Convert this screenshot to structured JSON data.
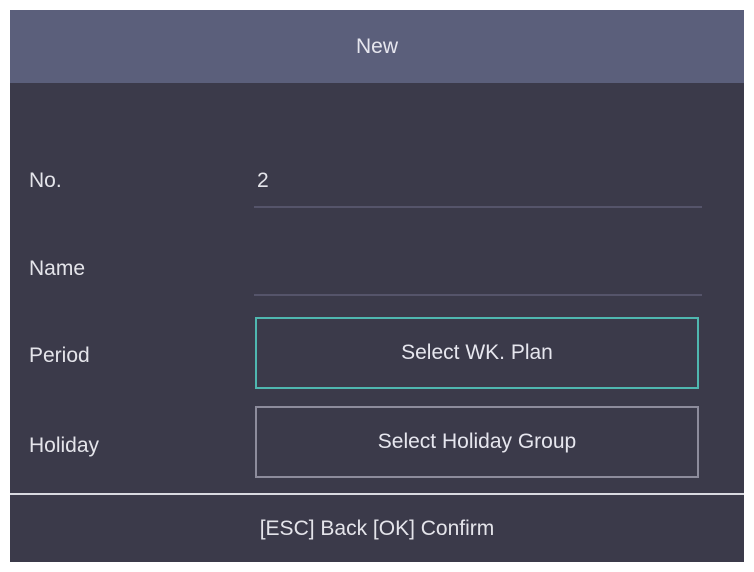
{
  "dialog": {
    "title": "New"
  },
  "fields": {
    "number": {
      "label": "No.",
      "value": "2"
    },
    "name": {
      "label": "Name",
      "value": ""
    },
    "period": {
      "label": "Period",
      "button_label": "Select WK. Plan"
    },
    "holiday": {
      "label": "Holiday",
      "button_label": "Select Holiday Group"
    }
  },
  "footer": {
    "hint": "[ESC] Back [OK] Confirm"
  },
  "colors": {
    "title_bar": "#5b5f7b",
    "background": "#3b3a4a",
    "focus_border": "#4fb7b0",
    "button_border": "#8d8c9c"
  }
}
